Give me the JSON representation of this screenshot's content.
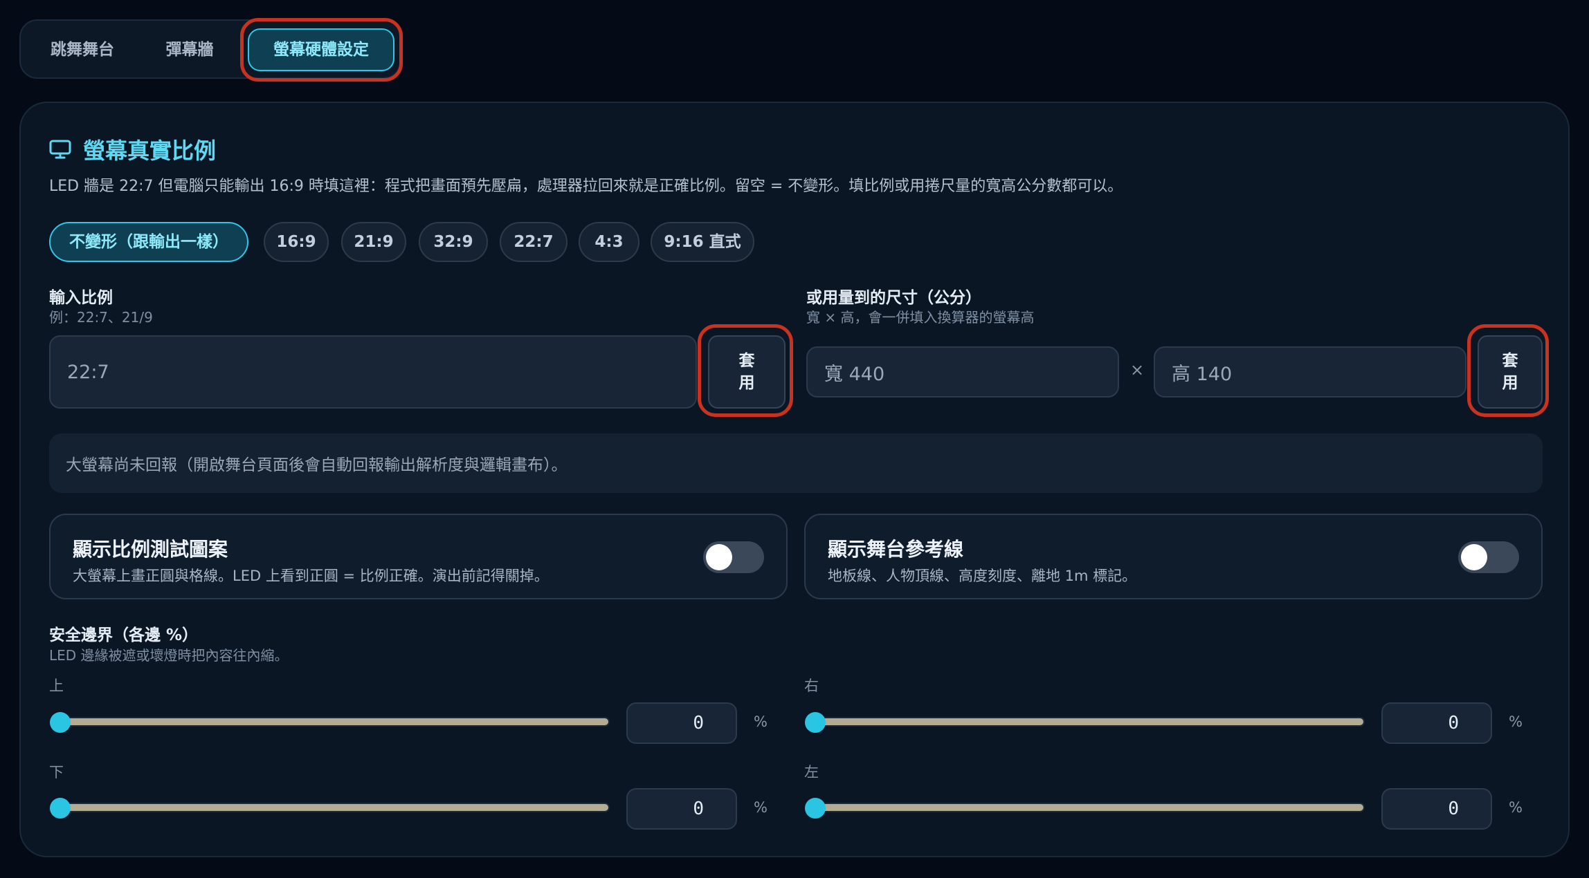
{
  "tabs": [
    {
      "label": "跳舞舞台",
      "active": false
    },
    {
      "label": "彈幕牆",
      "active": false
    },
    {
      "label": "螢幕硬體設定",
      "active": true
    }
  ],
  "ratio_section": {
    "icon": "monitor-icon",
    "title": "螢幕真實比例",
    "description": "LED 牆是 22:7 但電腦只能輸出 16:9 時填這裡：程式把畫面預先壓扁，處理器拉回來就是正確比例。留空 = 不變形。填比例或用捲尺量的寬高公分數都可以。"
  },
  "presets": [
    {
      "label": "不變形（跟輸出一樣）",
      "active": true
    },
    {
      "label": "16:9",
      "active": false
    },
    {
      "label": "21:9",
      "active": false
    },
    {
      "label": "32:9",
      "active": false
    },
    {
      "label": "22:7",
      "active": false
    },
    {
      "label": "4:3",
      "active": false
    },
    {
      "label": "9:16 直式",
      "active": false
    }
  ],
  "ratio_input": {
    "label": "輸入比例",
    "hint": "例：22:7、21/9",
    "value": "22:7",
    "apply_line1": "套",
    "apply_line2": "用"
  },
  "size_input": {
    "label": "或用量到的尺寸（公分）",
    "hint": "寬 × 高，會一併填入換算器的螢幕高",
    "width_value": "寬 440",
    "times": "×",
    "height_value": "高 140",
    "apply_line1": "套",
    "apply_line2": "用"
  },
  "notice": "大螢幕尚未回報（開啟舞台頁面後會自動回報輸出解析度與邏輯畫布）。",
  "toggles": [
    {
      "title": "顯示比例測試圖案",
      "description": "大螢幕上畫正圓與格線。LED 上看到正圓 = 比例正確。演出前記得關掉。",
      "on": false
    },
    {
      "title": "顯示舞台參考線",
      "description": "地板線、人物頂線、高度刻度、離地 1m 標記。",
      "on": false
    }
  ],
  "safe_area": {
    "label": "安全邊界（各邊 %）",
    "hint": "LED 邊緣被遮或壞燈時把內容往內縮。",
    "unit": "%",
    "sides": [
      {
        "name": "上",
        "value": "0"
      },
      {
        "name": "右",
        "value": "0"
      },
      {
        "name": "下",
        "value": "0"
      },
      {
        "name": "左",
        "value": "0"
      }
    ]
  },
  "colors": {
    "accent": "#2bc5e4",
    "highlight": "#c8321f",
    "background": "#040b16"
  }
}
